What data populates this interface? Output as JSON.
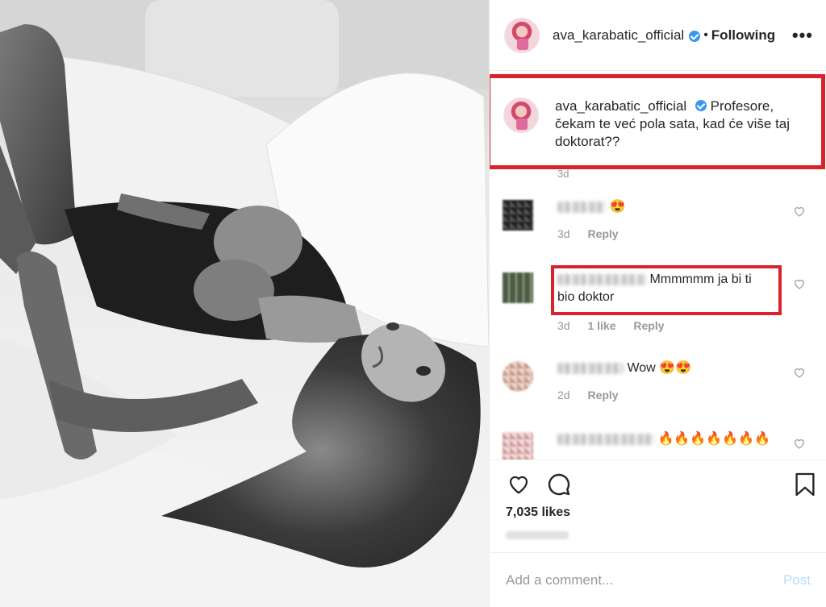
{
  "post": {
    "username": "ava_karabatic_official",
    "follow_label": "Following",
    "more_label": "•••",
    "image_alt_icon": "photo-image"
  },
  "caption": {
    "username": "ava_karabatic_official",
    "text": "Profesore, čekam te već pola sata, kad će više taj doktorat??",
    "time": "3d"
  },
  "comments": [
    {
      "text_suffix": "😍",
      "time": "3d",
      "likes": "",
      "reply": "Reply"
    },
    {
      "text_suffix": "Mmmmmm ja bi ti bio doktor",
      "time": "3d",
      "likes": "1 like",
      "reply": "Reply"
    },
    {
      "text_suffix": "Wow 😍😍",
      "time": "2d",
      "likes": "",
      "reply": "Reply"
    },
    {
      "text_suffix": "🔥🔥🔥🔥🔥🔥🔥",
      "time": "",
      "likes": "",
      "reply": ""
    }
  ],
  "actions": {
    "likes": "7,035 likes"
  },
  "add_comment": {
    "placeholder": "Add a comment...",
    "post_label": "Post"
  },
  "colors": {
    "highlight": "#d8232a",
    "verified": "#3897f0",
    "post_disabled": "#b2dffc"
  }
}
